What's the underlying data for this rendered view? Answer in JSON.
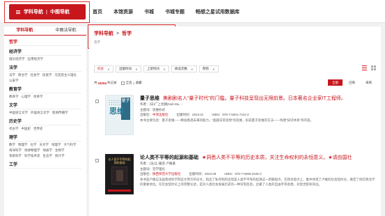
{
  "topnav": {
    "brand_left": "学科导航",
    "brand_right": "中图导航",
    "menu": [
      "首页",
      "本馆资源",
      "书城",
      "书城专题",
      "畅想之星试用数据库"
    ]
  },
  "sidebar": {
    "tabs": [
      "学科导航",
      "中图法导航"
    ],
    "categories": [
      {
        "name": "哲学",
        "subs": []
      },
      {
        "name": "经济学",
        "subs": [
          "理论经济学",
          "应用经济学"
        ]
      },
      {
        "name": "法学",
        "subs": [
          "法学",
          "政治学",
          "社会学",
          "民族学",
          "马克思主义理论",
          "公安学"
        ]
      },
      {
        "name": "教育学",
        "subs": [
          "教育学",
          "心理学",
          "体育学"
        ]
      },
      {
        "name": "文学",
        "subs": [
          "中国语言文学",
          "外国语言文学",
          "新闻传播学"
        ]
      },
      {
        "name": "历史学",
        "subs": [
          "考古学",
          "中国史",
          "世界史"
        ]
      },
      {
        "name": "理学",
        "subs": [
          "数学",
          "物理学",
          "化学",
          "天文学",
          "地理学",
          "大气科学",
          "海洋科学",
          "地球物理学",
          "地质学",
          "生物学",
          "系统科学",
          "科学技术史",
          "生态学",
          "统计学"
        ]
      },
      {
        "name": "工学",
        "subs": []
      }
    ]
  },
  "breadcrumb": {
    "root": "学科导航",
    "sep": ">",
    "current": "哲学",
    "sub": "哲学"
  },
  "sort": {
    "buttons": [
      "综合",
      "出版时间",
      "上架时间",
      "阅读次数",
      "荐购"
    ]
  },
  "results": {
    "prefix": "共",
    "count": "16294",
    "suffix": "条记录",
    "select_all": "全选",
    "favorite": "收藏",
    "filters": [
      "全部",
      "已购",
      "未购"
    ]
  },
  "books": [
    {
      "title": "量子思维",
      "highlight": "美剧剧名入“量子时代”的门槛。量子科技呈现出无限前景。日本著名企业家IT工程师。",
      "author": "作者：(日)广上亮朗(Nob Mu...",
      "subject": "主题词：思维形式",
      "publisher_label": "出版社：",
      "publisher": "中译出版社",
      "pub_date": "出版时间：2023.01",
      "isbn": "ISBN：978-7-5001-7110-2",
      "abstract": "本书主要包括：量子思维——精准看透未来的能力，“超越日常思想”的思维，形成量子思维的方法——构建“知识体系”等内容。",
      "cover_big": "思维",
      "cover_strip": "量子"
    },
    {
      "title": "论人类不平等的起源和基础",
      "highlight": "★洞悉人类不平等的历史本质，关注生命权利的永恒意义。★请由国社",
      "author": "作者：(法)让-雅克·卢梭著",
      "subject": "主题词：哲学理论",
      "publisher_label": "出版社：",
      "publisher": "陕西师范大学出版社",
      "pub_date": "出版时间：2023.09",
      "isbn": "ISBN：978-7-5695-3425-2",
      "abstract": "本书是卢梭应法国第戎科学院征文而写的论文，指出了私有制的出现是人类不平等的起源这一新颖观点，在政治观点上，集中体现了卢梭的社会契约论，奠定了他在政治学的重要地位。在社会契约论上的完整论述，是对人类社会发展历史的一种深刻反思。启蒙了人类的自由平等思想，对后世影响深远。",
      "cover_title": "论人类不平等的起源和基础"
    }
  ],
  "colors": {
    "accent": "#c8161d",
    "frame": "#e03030"
  },
  "icons": [
    "menu-icon",
    "triangle-down-icon",
    "list-view-icon",
    "grid-view-icon",
    "checkbox-icon"
  ]
}
